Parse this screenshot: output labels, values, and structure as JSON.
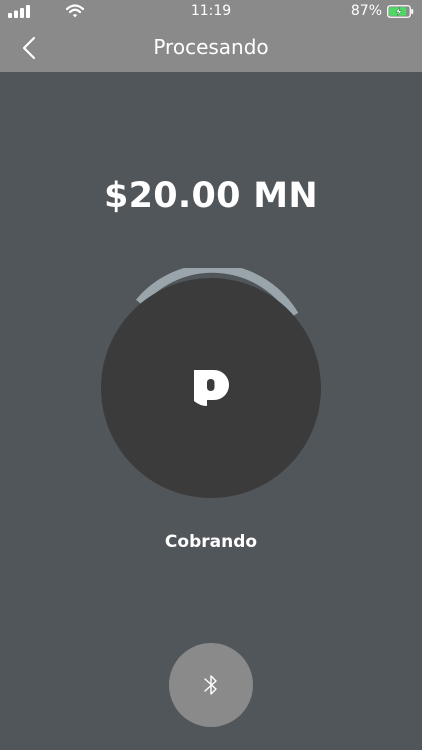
{
  "status_bar": {
    "time": "11:19",
    "battery_percent": "87%",
    "battery_level": 0.87,
    "charging": true,
    "battery_accent": "#4cd964"
  },
  "nav": {
    "title": "Procesando",
    "back_icon": "chevron-left-icon"
  },
  "payment": {
    "amount": "$20.00 MN",
    "status": "Cobrando",
    "logo_icon": "brand-p-logo",
    "progress_arc_color": "#9aa4ab",
    "circle_color": "#3b3b3b"
  },
  "bluetooth": {
    "icon": "bluetooth-icon"
  },
  "colors": {
    "background": "#51565a",
    "bar": "#8a8a8a"
  }
}
